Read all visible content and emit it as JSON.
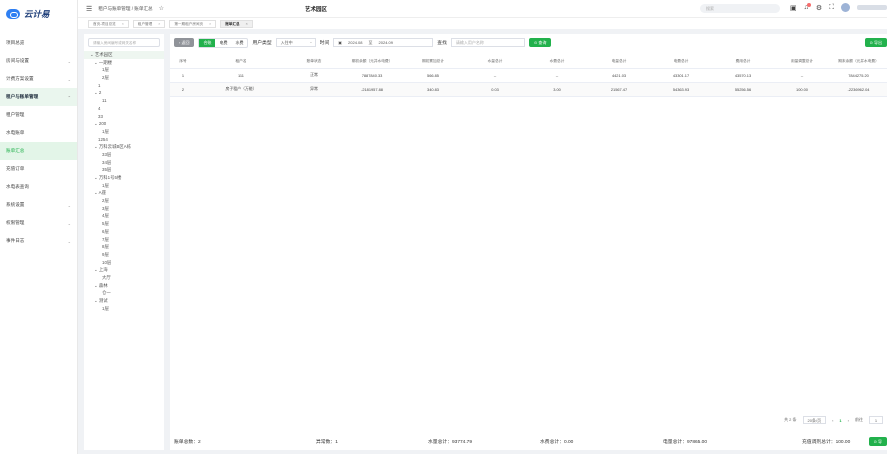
{
  "app": {
    "logo_text": "云计易"
  },
  "sidebar": {
    "items": [
      {
        "label": "项目总览",
        "has_children": false
      },
      {
        "label": "房间与设置",
        "has_children": true
      },
      {
        "label": "计费方案设置",
        "has_children": true
      },
      {
        "label": "租户与账单管理",
        "has_children": true,
        "expanded": true
      },
      {
        "label": "租户管理",
        "has_children": false
      },
      {
        "label": "水电账单",
        "has_children": false
      },
      {
        "label": "账单汇总",
        "has_children": false,
        "active": true
      },
      {
        "label": "充值订单",
        "has_children": false
      },
      {
        "label": "水电表查询",
        "has_children": false
      },
      {
        "label": "系统设置",
        "has_children": true
      },
      {
        "label": "权限管理",
        "has_children": true
      },
      {
        "label": "事件日志",
        "has_children": true
      }
    ]
  },
  "topbar": {
    "breadcrumb": "租户与账单管理 / 账单汇总",
    "center_title": "艺术园区",
    "search_placeholder": "搜索"
  },
  "tabs": [
    {
      "label": "首页-项目总览"
    },
    {
      "label": "租户管理"
    },
    {
      "label": "第一期租户房间页"
    },
    {
      "label": "账单汇总",
      "active": true
    }
  ],
  "tree": {
    "search_placeholder": "请输入房间编号或网关名称",
    "nodes": [
      {
        "label": "⌄ 艺术园区",
        "indent": 0,
        "selected": true
      },
      {
        "label": "⌄ 一期楼",
        "indent": 1
      },
      {
        "label": "1层",
        "indent": 3
      },
      {
        "label": "2层",
        "indent": 3
      },
      {
        "label": "1",
        "indent": 2
      },
      {
        "label": "⌄ 2",
        "indent": 1
      },
      {
        "label": "11",
        "indent": 3
      },
      {
        "label": "4",
        "indent": 2
      },
      {
        "label": "33",
        "indent": 2
      },
      {
        "label": "⌄ 200",
        "indent": 1
      },
      {
        "label": "1层",
        "indent": 3
      },
      {
        "label": "1254",
        "indent": 2
      },
      {
        "label": "⌄ 万科云城B区A栋",
        "indent": 1
      },
      {
        "label": "33层",
        "indent": 3
      },
      {
        "label": "34层",
        "indent": 3
      },
      {
        "label": "35层",
        "indent": 3
      },
      {
        "label": "⌄ 万科1号5楼",
        "indent": 1
      },
      {
        "label": "1层",
        "indent": 3
      },
      {
        "label": "⌄ A座",
        "indent": 1
      },
      {
        "label": "2层",
        "indent": 3
      },
      {
        "label": "3层",
        "indent": 3
      },
      {
        "label": "4层",
        "indent": 3
      },
      {
        "label": "5层",
        "indent": 3
      },
      {
        "label": "6层",
        "indent": 3
      },
      {
        "label": "7层",
        "indent": 3
      },
      {
        "label": "8层",
        "indent": 3
      },
      {
        "label": "9层",
        "indent": 3
      },
      {
        "label": "10层",
        "indent": 3
      },
      {
        "label": "⌄ 上海",
        "indent": 1
      },
      {
        "label": "大厅",
        "indent": 3
      },
      {
        "label": "⌄ 森林",
        "indent": 1
      },
      {
        "label": "仓一",
        "indent": 3
      },
      {
        "label": "⌄ 测试",
        "indent": 1
      },
      {
        "label": "1层",
        "indent": 3
      }
    ]
  },
  "toolbar": {
    "back_label": "‹ 返回",
    "segments": [
      {
        "label": "合账",
        "on": true
      },
      {
        "label": "电费",
        "on": false
      },
      {
        "label": "水费",
        "on": false
      }
    ],
    "user_type_label": "用户类型",
    "user_type_value": "入住中",
    "time_label": "时间",
    "date_start": "2024.08",
    "date_sep": "至",
    "date_end": "2024.09",
    "query_label": "查找",
    "query_placeholder": "请输入用户名称",
    "search_button": "⊙ 查询",
    "right_button": "⊙ 导出"
  },
  "table": {
    "headers": [
      "序号",
      "租户名",
      "账单状态",
      "期初余额（元并水电费）",
      "期初累加总计",
      "水量总计",
      "水费总计",
      "电量总计",
      "电费总计",
      "费用总计",
      "用量调整总计",
      "期末余额（元并水电费）"
    ],
    "rows": [
      [
        "1",
        "111",
        "正常",
        "7887840.33",
        "566.85",
        "--",
        "--",
        "4421.03",
        "43301.17",
        "43570.13",
        "--",
        "7844275.20"
      ],
      [
        "2",
        "房子租户（万能）",
        "异常",
        "-2181957.88",
        "340.83",
        "0.03",
        "3.00",
        "21567.47",
        "54363.93",
        "55256.56",
        "100.00",
        "-2236962.04"
      ]
    ]
  },
  "pager": {
    "total": "共 2 条",
    "page_size": "20条/页",
    "prev": "‹",
    "current": "1",
    "next": "›",
    "goto_label": "前往",
    "goto_value": "1"
  },
  "summary": {
    "bill_count": "账单总数：2",
    "abnormal_count": "异常数：1",
    "water_qty_total": "水量总计：93774.79",
    "water_fee_total": "水费总计：0.00",
    "power_total": "电量总计：97865.00",
    "adjust_total": "充值调剂总计：100.00",
    "right_button": "⊙ 导"
  },
  "colors": {
    "accent": "#22b14c",
    "brand": "#2f7ff2"
  }
}
